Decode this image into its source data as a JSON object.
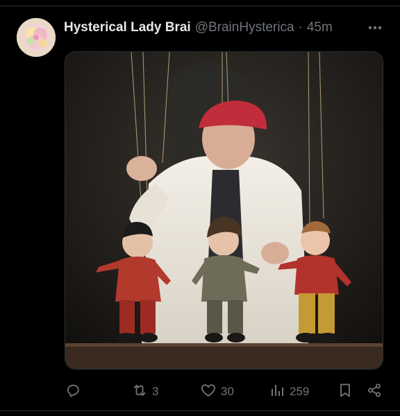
{
  "post": {
    "author_name": "Hysterical Lady Brai",
    "author_handle": "@BrainHysterica",
    "separator": "·",
    "timestamp": "45m"
  },
  "actions": {
    "reply_count": "",
    "repost_count": "3",
    "like_count": "30",
    "views_count": "259"
  },
  "icons": {
    "more": "more-icon",
    "reply": "reply-icon",
    "repost": "repost-icon",
    "like": "heart-icon",
    "views": "views-icon",
    "bookmark": "bookmark-icon",
    "share": "share-icon"
  },
  "colors": {
    "background": "#000000",
    "text": "#e7e9ea",
    "muted": "#71767b",
    "divider": "#2f3336"
  }
}
